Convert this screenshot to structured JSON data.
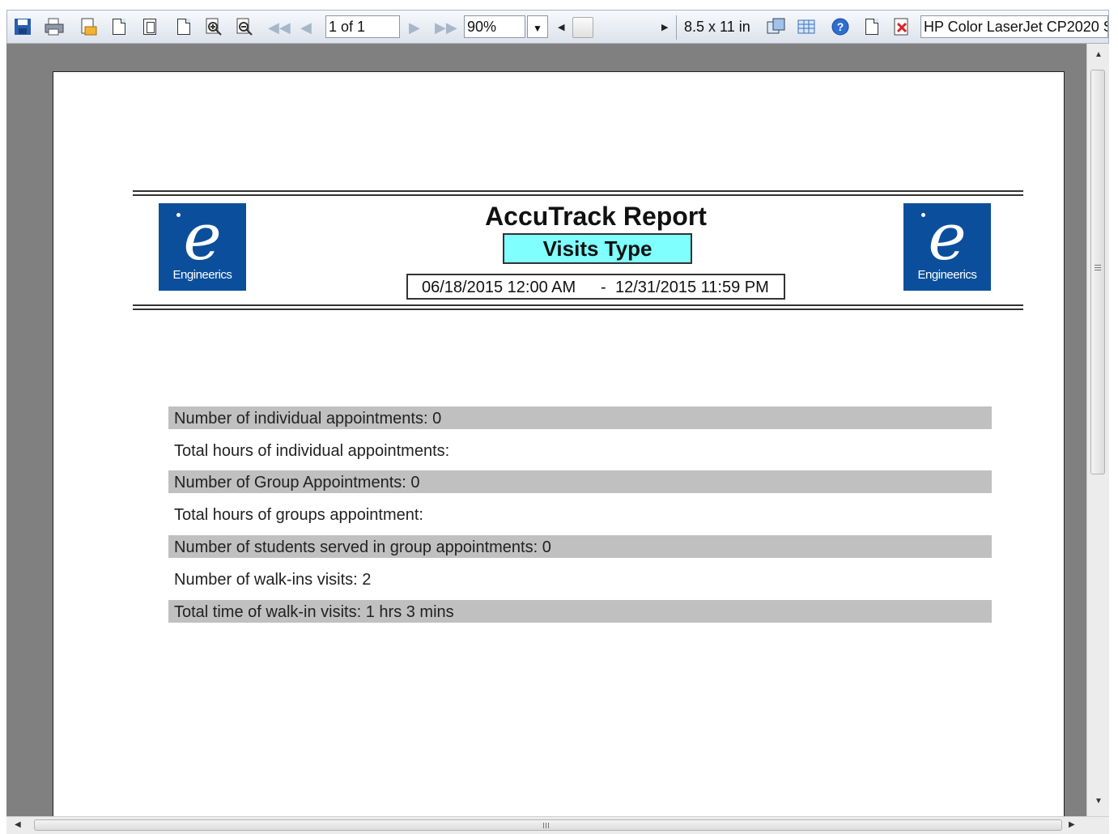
{
  "toolbar": {
    "icons": [
      "save-icon",
      "print-icon",
      "page-setup-icon",
      "single-page-icon",
      "two-pages-icon",
      "four-pages-icon",
      "zoom-in-icon",
      "zoom-out-icon",
      "first-page-icon",
      "previous-page-icon",
      "next-page-icon",
      "last-page-icon",
      "page-size-icon",
      "table-icon",
      "help-icon",
      "blank-page-icon",
      "close-icon"
    ],
    "page_indicator": "1 of 1",
    "zoom": "90%",
    "paper_size": "8.5 x 11 in",
    "printer": "HP Color LaserJet CP2020 S"
  },
  "report": {
    "title": "AccuTrack Report",
    "subtitle": "Visits Type",
    "date_from": "06/18/2015 12:00 AM",
    "date_separator": "-",
    "date_to": "12/31/2015 11:59 PM",
    "logo_text": "Engineerics",
    "rows": [
      "Number of individual appointments: 0",
      "Total hours of individual appointments:",
      "Number of Group Appointments: 0",
      "Total hours of groups appointment:",
      "Number of students served in group appointments: 0",
      "Number of walk-ins visits: 2",
      "Total time of walk-in visits: 1 hrs 3 mins"
    ]
  },
  "colors": {
    "viewer_bg": "#808080",
    "logo_blue": "#0b4f9c",
    "subtitle_bg": "#80ffff",
    "row_shade": "#c0c0c0"
  }
}
